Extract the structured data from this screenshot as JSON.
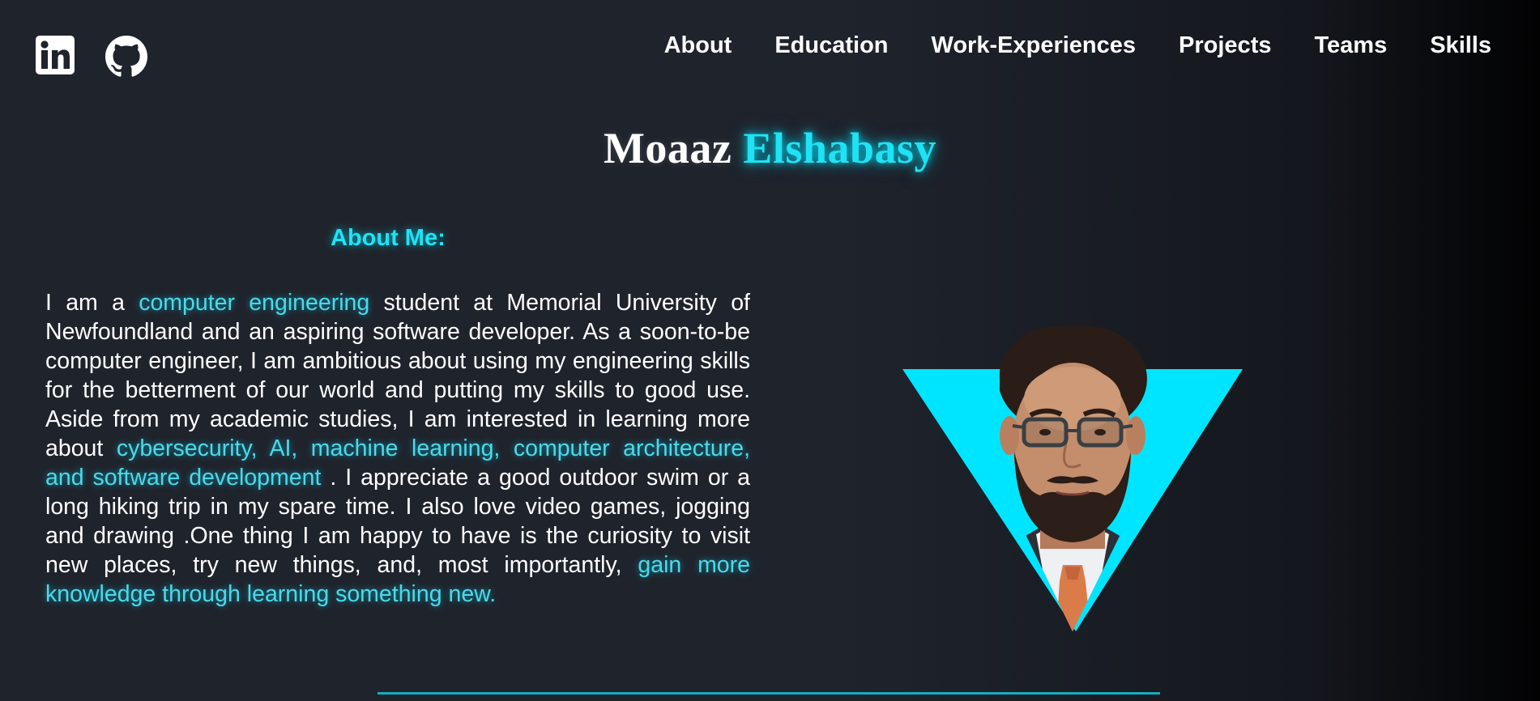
{
  "social": {
    "linkedin_icon": "linkedin-icon",
    "github_icon": "github-icon"
  },
  "nav": {
    "items": [
      "About",
      "Education",
      "Work-Experiences",
      "Projects",
      "Teams",
      "Skills"
    ]
  },
  "hero": {
    "first_name": "Moaaz",
    "last_name": "Elshabasy"
  },
  "about": {
    "title": "About Me:",
    "text": {
      "p1": "I am a ",
      "h1": "computer engineering",
      "p2": " student at Memorial University of Newfoundland and an aspiring software developer. As a soon-to-be computer engineer, I am ambitious about using my engineering skills for the betterment of our world and putting my skills to good use. Aside from my academic studies, I am interested in learning more about ",
      "h2": "cybersecurity, AI, machine learning, computer architecture, and software development",
      "p3": " . I appreciate a good outdoor swim or a long hiking trip in my spare time. I also love video games, jogging and drawing .One thing I am happy to have is the curiosity to visit new places, try new things, and, most importantly, ",
      "h3": "gain more knowledge through learning something new."
    }
  },
  "colors": {
    "accent": "#1fe3f4",
    "background": "#1f232c",
    "triangle": "#00e5ff",
    "divider": "#14aebf"
  }
}
